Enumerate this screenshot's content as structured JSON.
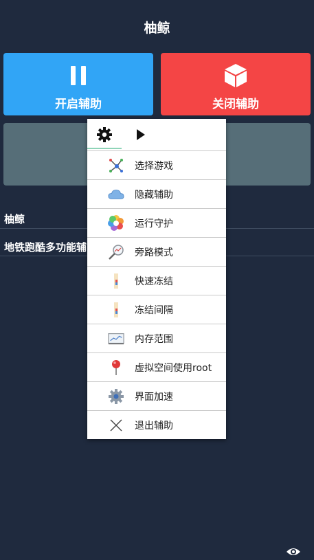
{
  "header": {
    "title": "柚鲸"
  },
  "buttons": {
    "start_label": "开启辅助",
    "stop_label": "关闭辅助"
  },
  "list": {
    "item1": "柚鲸",
    "item2": "地铁跑酷多功能辅"
  },
  "menu": {
    "head_icons": [
      "gear-icon",
      "play-icon"
    ],
    "items": [
      {
        "label": "选择游戏",
        "icon": "network-icon"
      },
      {
        "label": "隐藏辅助",
        "icon": "cloud-icon"
      },
      {
        "label": "运行守护",
        "icon": "flower-icon"
      },
      {
        "label": "旁路模式",
        "icon": "magnifier-chart-icon"
      },
      {
        "label": "快速冻结",
        "icon": "bar-icon"
      },
      {
        "label": "冻结间隔",
        "icon": "bar-icon"
      },
      {
        "label": "内存范围",
        "icon": "monitor-chart-icon"
      },
      {
        "label": "虚拟空间使用root",
        "icon": "pin-icon"
      },
      {
        "label": "界面加速",
        "icon": "gear-icon"
      },
      {
        "label": "退出辅助",
        "icon": "close-icon"
      }
    ]
  },
  "colors": {
    "background": "#1f2a3e",
    "start_button": "#31a5f6",
    "stop_button": "#f44545",
    "panel": "#566e78"
  }
}
